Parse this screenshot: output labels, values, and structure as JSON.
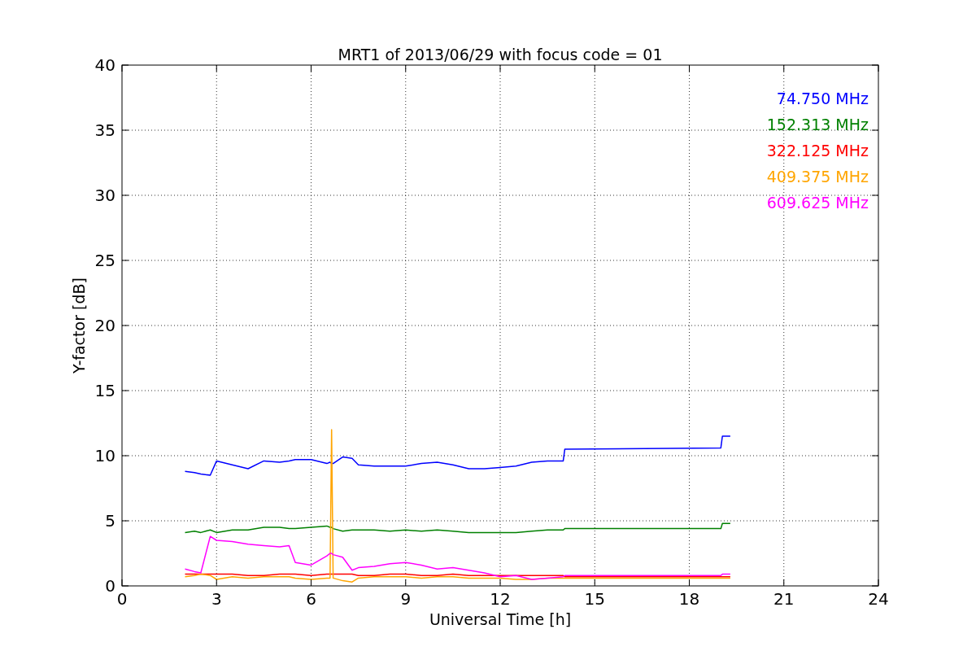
{
  "chart_data": {
    "type": "line",
    "title": "MRT1 of 2013/06/29 with focus code = 01",
    "xlabel": "Universal Time [h]",
    "ylabel": "Y-factor [dB]",
    "grid": true,
    "xlim": [
      0,
      24
    ],
    "ylim": [
      0,
      40
    ],
    "xticks": [
      0,
      3,
      6,
      9,
      12,
      15,
      18,
      21,
      24
    ],
    "yticks": [
      0,
      5,
      10,
      15,
      20,
      25,
      30,
      35,
      40
    ],
    "x": [
      2,
      2.3,
      2.5,
      2.8,
      3,
      3.5,
      4,
      4.5,
      5,
      5.3,
      5.5,
      6,
      6.5,
      6.6,
      6.65,
      6.7,
      7,
      7.3,
      7.5,
      8,
      8.5,
      9,
      9.5,
      10,
      10.5,
      11,
      11.5,
      12,
      12.5,
      13,
      13.5,
      14,
      14.05,
      19,
      19.05,
      19.3
    ],
    "series": [
      {
        "name": "74.750 MHz",
        "color": "#0000ff",
        "values": [
          8.8,
          8.7,
          8.6,
          8.5,
          9.6,
          9.3,
          9.0,
          9.6,
          9.5,
          9.6,
          9.7,
          9.7,
          9.4,
          9.5,
          9.4,
          9.4,
          9.9,
          9.8,
          9.3,
          9.2,
          9.2,
          9.2,
          9.4,
          9.5,
          9.3,
          9.0,
          9.0,
          9.1,
          9.2,
          9.5,
          9.6,
          9.6,
          10.5,
          10.6,
          11.5,
          11.5
        ]
      },
      {
        "name": "152.313 MHz",
        "color": "#008000",
        "values": [
          4.1,
          4.2,
          4.1,
          4.3,
          4.1,
          4.3,
          4.3,
          4.5,
          4.5,
          4.4,
          4.4,
          4.5,
          4.6,
          4.5,
          4.5,
          4.4,
          4.2,
          4.3,
          4.3,
          4.3,
          4.2,
          4.3,
          4.2,
          4.3,
          4.2,
          4.1,
          4.1,
          4.1,
          4.1,
          4.2,
          4.3,
          4.3,
          4.4,
          4.4,
          4.8,
          4.8
        ]
      },
      {
        "name": "322.125 MHz",
        "color": "#ff0000",
        "values": [
          0.9,
          0.9,
          0.9,
          0.9,
          0.9,
          0.9,
          0.8,
          0.8,
          0.9,
          0.9,
          0.9,
          0.8,
          0.9,
          0.9,
          0.9,
          0.9,
          0.9,
          0.9,
          0.8,
          0.8,
          0.9,
          0.9,
          0.8,
          0.8,
          0.9,
          0.8,
          0.8,
          0.8,
          0.8,
          0.8,
          0.8,
          0.8,
          0.7,
          0.7,
          0.7,
          0.7
        ]
      },
      {
        "name": "409.375 MHz",
        "color": "#ffa500",
        "values": [
          0.7,
          0.8,
          0.9,
          0.8,
          0.5,
          0.7,
          0.6,
          0.7,
          0.7,
          0.7,
          0.6,
          0.5,
          0.6,
          0.6,
          12.0,
          0.6,
          0.4,
          0.3,
          0.6,
          0.7,
          0.7,
          0.7,
          0.6,
          0.7,
          0.7,
          0.6,
          0.6,
          0.6,
          0.5,
          0.5,
          0.6,
          0.6,
          0.6,
          0.6,
          0.6,
          0.6
        ]
      },
      {
        "name": "609.625 MHz",
        "color": "#ff00ff",
        "values": [
          1.3,
          1.1,
          1.0,
          3.8,
          3.5,
          3.4,
          3.2,
          3.1,
          3.0,
          3.1,
          1.8,
          1.6,
          2.3,
          2.5,
          2.5,
          2.4,
          2.2,
          1.2,
          1.4,
          1.5,
          1.7,
          1.8,
          1.6,
          1.3,
          1.4,
          1.2,
          1.0,
          0.7,
          0.8,
          0.5,
          0.6,
          0.7,
          0.8,
          0.8,
          0.9,
          0.9
        ]
      }
    ]
  }
}
